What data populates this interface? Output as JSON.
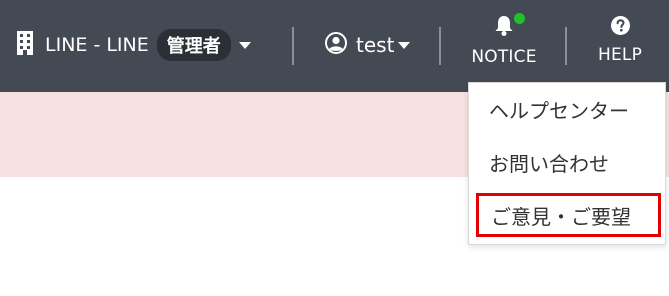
{
  "header": {
    "org_name": "LINE - LINE",
    "role_badge": "管理者",
    "user_name": "test",
    "notice_label": "NOTICE",
    "help_label": "HELP"
  },
  "help_menu": {
    "items": [
      {
        "label": "ヘルプセンター"
      },
      {
        "label": "お問い合わせ"
      },
      {
        "label": "ご意見・ご要望"
      }
    ]
  },
  "colors": {
    "header_bg": "#444a54",
    "badge_bg": "#2b2f36",
    "notification_dot": "#1fc12b",
    "banner_bg": "#f7e1e1",
    "highlight_border": "#e10000"
  },
  "icons": [
    "building-icon",
    "user-circle-icon",
    "bell-icon",
    "question-circle-icon",
    "chevron-down-icon"
  ]
}
